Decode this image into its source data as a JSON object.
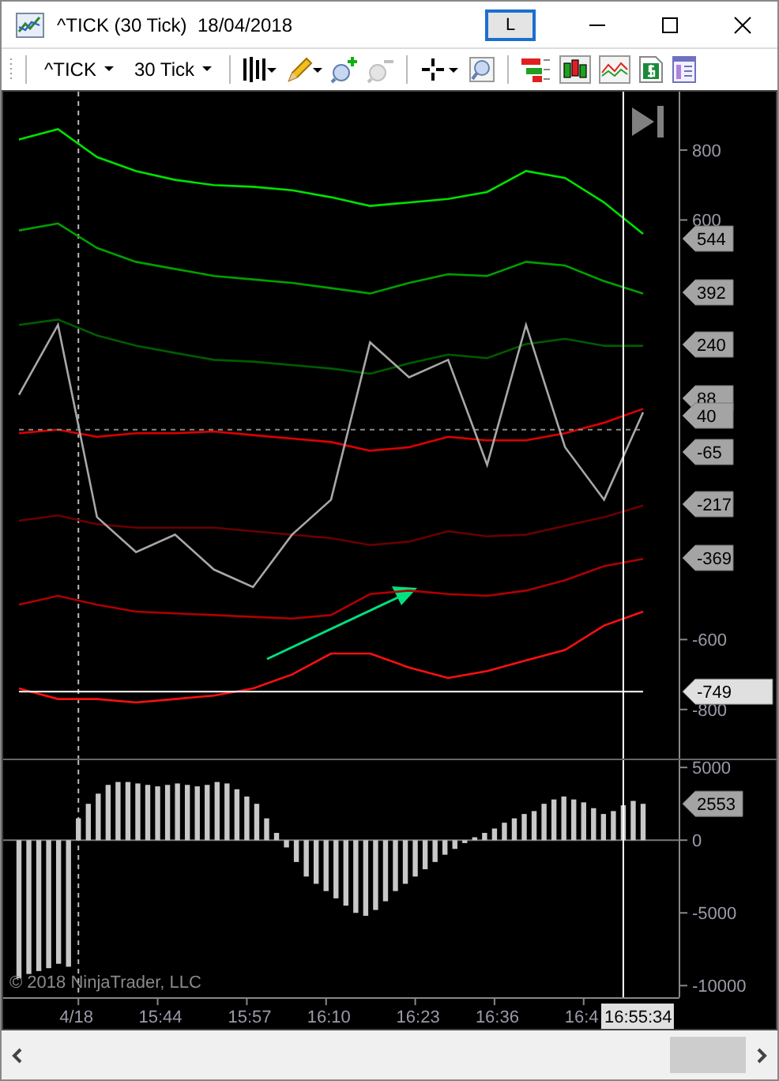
{
  "window": {
    "title": "^TICK (30 Tick)  18/04/2018",
    "link_button": "L"
  },
  "toolbar": {
    "instrument": "^TICK",
    "interval": "30 Tick"
  },
  "price_panel": {
    "chart_data": {
      "type": "line",
      "categories": [
        null,
        null,
        null,
        null,
        null,
        null,
        null,
        null,
        null,
        null,
        null,
        null,
        null,
        null,
        null,
        null,
        null
      ],
      "ylim": [
        -945,
        967
      ],
      "yticks": [
        800,
        600,
        -600,
        -800
      ],
      "series": [
        {
          "color": "#00e000",
          "values": [
            830,
            860,
            780,
            740,
            715,
            700,
            695,
            685,
            665,
            640,
            650,
            660,
            680,
            740,
            720,
            650,
            560
          ]
        },
        {
          "color": "#00a000",
          "values": [
            570,
            590,
            520,
            480,
            460,
            440,
            430,
            420,
            405,
            390,
            420,
            445,
            440,
            480,
            470,
            425,
            390
          ]
        },
        {
          "color": "#005c00",
          "values": [
            300,
            315,
            270,
            240,
            220,
            200,
            195,
            185,
            175,
            160,
            190,
            215,
            205,
            245,
            260,
            240,
            240
          ]
        },
        {
          "color": "#e00000",
          "values": [
            -10,
            0,
            -20,
            -10,
            -10,
            -5,
            -15,
            -25,
            -35,
            -60,
            -50,
            -20,
            -30,
            -30,
            -10,
            20,
            60
          ]
        },
        {
          "color": "#6a0000",
          "values": [
            -260,
            -245,
            -270,
            -280,
            -280,
            -280,
            -290,
            -300,
            -310,
            -330,
            -320,
            -290,
            -305,
            -300,
            -275,
            -250,
            -217
          ]
        },
        {
          "color": "#b00000",
          "values": [
            -500,
            -475,
            -500,
            -520,
            -525,
            -530,
            -535,
            -540,
            -530,
            -470,
            -460,
            -470,
            -475,
            -460,
            -430,
            -390,
            -369
          ]
        },
        {
          "color": "#ff1010",
          "values": [
            -740,
            -770,
            -770,
            -780,
            -770,
            -760,
            -740,
            -700,
            -640,
            -640,
            -680,
            -710,
            -690,
            -660,
            -630,
            -560,
            -520
          ]
        },
        {
          "color": "#888888",
          "line_style": "dashed",
          "values": [
            0,
            0,
            0,
            0,
            0,
            0,
            0,
            0,
            0,
            0,
            0,
            0,
            0,
            0,
            0,
            0,
            0
          ]
        },
        {
          "color": "#ffffff",
          "values": [
            -749,
            -749,
            -749,
            -749,
            -749,
            -749,
            -749,
            -749,
            -749,
            -749,
            -749,
            -749,
            -749,
            -749,
            -749,
            -749,
            -749
          ]
        },
        {
          "color": "#a8a8a8",
          "values": [
            100,
            300,
            -250,
            -350,
            -300,
            -400,
            -450,
            -300,
            -200,
            250,
            150,
            200,
            -100,
            300,
            -50,
            -200,
            50
          ]
        }
      ]
    },
    "price_tags": [
      "544",
      "392",
      "240",
      "88",
      "40",
      "-65",
      "-217",
      "-369"
    ],
    "line_tag": "-749"
  },
  "indicator_panel": {
    "chart_data": {
      "type": "bar",
      "ylim": [
        -10800,
        5500
      ],
      "yticks": [
        5000,
        0,
        -5000,
        -10000
      ],
      "categories": [
        null,
        null,
        null,
        null,
        null,
        null,
        "4/18",
        null,
        null,
        null,
        null,
        null,
        null,
        null,
        "15:44",
        null,
        null,
        null,
        null,
        null,
        null,
        null,
        null,
        "15:57",
        null,
        null,
        null,
        null,
        null,
        null,
        null,
        "16:10",
        null,
        null,
        null,
        null,
        null,
        null,
        null,
        null,
        "16:23",
        null,
        null,
        null,
        null,
        null,
        null,
        null,
        "16:36",
        null,
        null,
        null,
        null,
        null,
        null,
        null,
        null,
        "16:4",
        null,
        null,
        null,
        null,
        null,
        null
      ],
      "series": [
        {
          "color": "#c8c8c8",
          "values": [
            -9500,
            -9200,
            -9000,
            -8800,
            -8500,
            -8700,
            1500,
            2500,
            3200,
            3800,
            4000,
            4000,
            3900,
            3800,
            3700,
            3800,
            3900,
            3800,
            3700,
            3800,
            4000,
            3900,
            3500,
            3000,
            2500,
            1500,
            500,
            -500,
            -1500,
            -2500,
            -3000,
            -3500,
            -4000,
            -4500,
            -5000,
            -5200,
            -4800,
            -4200,
            -3500,
            -3000,
            -2500,
            -2000,
            -1500,
            -1000,
            -600,
            -200,
            200,
            500,
            800,
            1200,
            1500,
            1800,
            2000,
            2500,
            2800,
            3000,
            2800,
            2600,
            2200,
            1800,
            2000,
            2400,
            2700,
            2500
          ]
        }
      ]
    },
    "value_tag": "2553",
    "cursor_label": "16:55:34",
    "copyright": "© 2018 NinjaTrader, LLC"
  }
}
